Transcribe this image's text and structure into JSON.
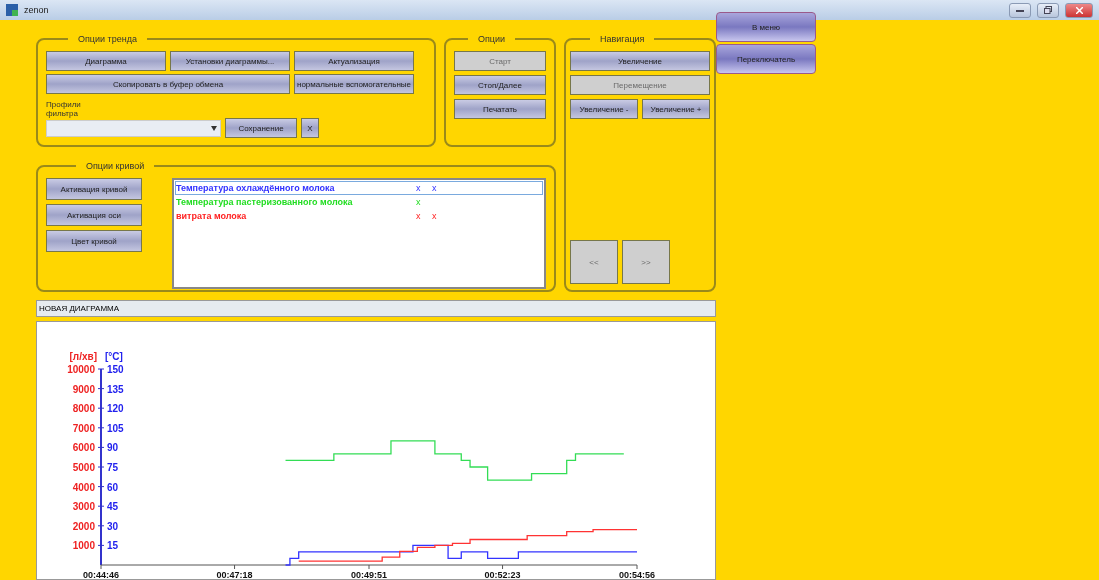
{
  "window": {
    "title": "zenon"
  },
  "side_buttons": [
    {
      "label": "В меню",
      "disabled": false
    },
    {
      "label": "Переключатель",
      "disabled": false
    }
  ],
  "trend_options": {
    "title": "Опции тренда",
    "button_rows": [
      [
        {
          "label": "Диаграмма",
          "disabled": false
        },
        {
          "label": "Установки диаграммы...",
          "disabled": false
        },
        {
          "label": "Актуализация",
          "disabled": false
        }
      ],
      [
        {
          "label": "Скопировать в буфер обмена",
          "disabled": false
        },
        {
          "label": "нормальные вспомогательные",
          "disabled": false
        }
      ]
    ],
    "filter_label": "Профили фильтра",
    "save_button": "Сохранение",
    "clear_button": "X"
  },
  "options": {
    "title": "Опции",
    "buttons": [
      {
        "label": "Старт",
        "disabled": true
      },
      {
        "label": "Стоп/Далее",
        "disabled": false
      },
      {
        "label": "Печатать",
        "disabled": false
      }
    ]
  },
  "navigation": {
    "title": "Навигация",
    "button_rows": [
      [
        {
          "label": "Увеличение",
          "disabled": false
        }
      ],
      [
        {
          "label": "Перемещение",
          "disabled": true
        }
      ],
      [
        {
          "label": "Увеличение -",
          "disabled": false
        },
        {
          "label": "Увеличение +",
          "disabled": false
        }
      ]
    ],
    "scroll_buttons": [
      {
        "label": "<<",
        "disabled": true
      },
      {
        "label": ">>",
        "disabled": true
      }
    ]
  },
  "curve_options": {
    "title": "Опции кривой",
    "buttons": [
      {
        "label": "Активация кривой",
        "disabled": false
      },
      {
        "label": "Активация оси",
        "disabled": false
      },
      {
        "label": "Цвет кривой",
        "disabled": false
      }
    ],
    "curves": [
      {
        "label": "Температура охлаждённого молока",
        "color": "#3333ff",
        "marks": [
          "x",
          "x"
        ],
        "selected": true
      },
      {
        "label": "Температура пастеризованного молока",
        "color": "#22dd22",
        "marks": [
          "x"
        ],
        "selected": false
      },
      {
        "label": "витрата молока",
        "color": "#ff2222",
        "marks": [
          "x",
          "x"
        ],
        "selected": false
      }
    ]
  },
  "diagram": {
    "title": "НОВАЯ ДИАГРАММА",
    "chart_data": {
      "type": "line",
      "xlim": [
        2686,
        3296
      ],
      "ylim": [
        0,
        10000
      ],
      "y2lim": [
        0,
        150
      ],
      "xticks": [
        {
          "value": 2686,
          "label": "00:44:46"
        },
        {
          "value": 2838,
          "label": "00:47:18"
        },
        {
          "value": 2991,
          "label": "00:49:51"
        },
        {
          "value": 3143,
          "label": "00:52:23"
        },
        {
          "value": 3296,
          "label": "00:54:56"
        }
      ],
      "yticks": [
        1000,
        2000,
        3000,
        4000,
        5000,
        6000,
        7000,
        8000,
        9000,
        10000
      ],
      "y2ticks": [
        15,
        30,
        45,
        60,
        75,
        90,
        105,
        120,
        135,
        150
      ],
      "ylabel": "[л/хв]",
      "y2label": "[°C]",
      "series": [
        {
          "color": "#33dd55",
          "axis": "y2",
          "x": [
            2896,
            2951,
            2951,
            3016,
            3016,
            3066,
            3066,
            3096,
            3096,
            3106,
            3106,
            3126,
            3126,
            3176,
            3176,
            3216,
            3216,
            3226,
            3226,
            3281
          ],
          "values": [
            80,
            80,
            85,
            85,
            95,
            95,
            85,
            85,
            80,
            80,
            75,
            75,
            65,
            65,
            70,
            70,
            80,
            80,
            85,
            85
          ]
        },
        {
          "color": "#3333ff",
          "axis": "y2",
          "x": [
            2896,
            2901,
            2901,
            2911,
            2911,
            3041,
            3041,
            3081,
            3081,
            3096,
            3096,
            3126,
            3126,
            3161,
            3161,
            3296
          ],
          "values": [
            0,
            0,
            5,
            5,
            10,
            10,
            15,
            15,
            5,
            5,
            10,
            10,
            5,
            5,
            10,
            10
          ]
        },
        {
          "color": "#ff3333",
          "x": [
            2911,
            3006,
            3006,
            3026,
            3026,
            3046,
            3046,
            3066,
            3066,
            3086,
            3086,
            3106,
            3106,
            3171,
            3171,
            3216,
            3216,
            3246,
            3246,
            3296
          ],
          "values": [
            200,
            200,
            400,
            400,
            700,
            700,
            900,
            900,
            1000,
            1000,
            1100,
            1100,
            1300,
            1300,
            1500,
            1500,
            1700,
            1700,
            1800,
            1800
          ]
        }
      ]
    }
  }
}
